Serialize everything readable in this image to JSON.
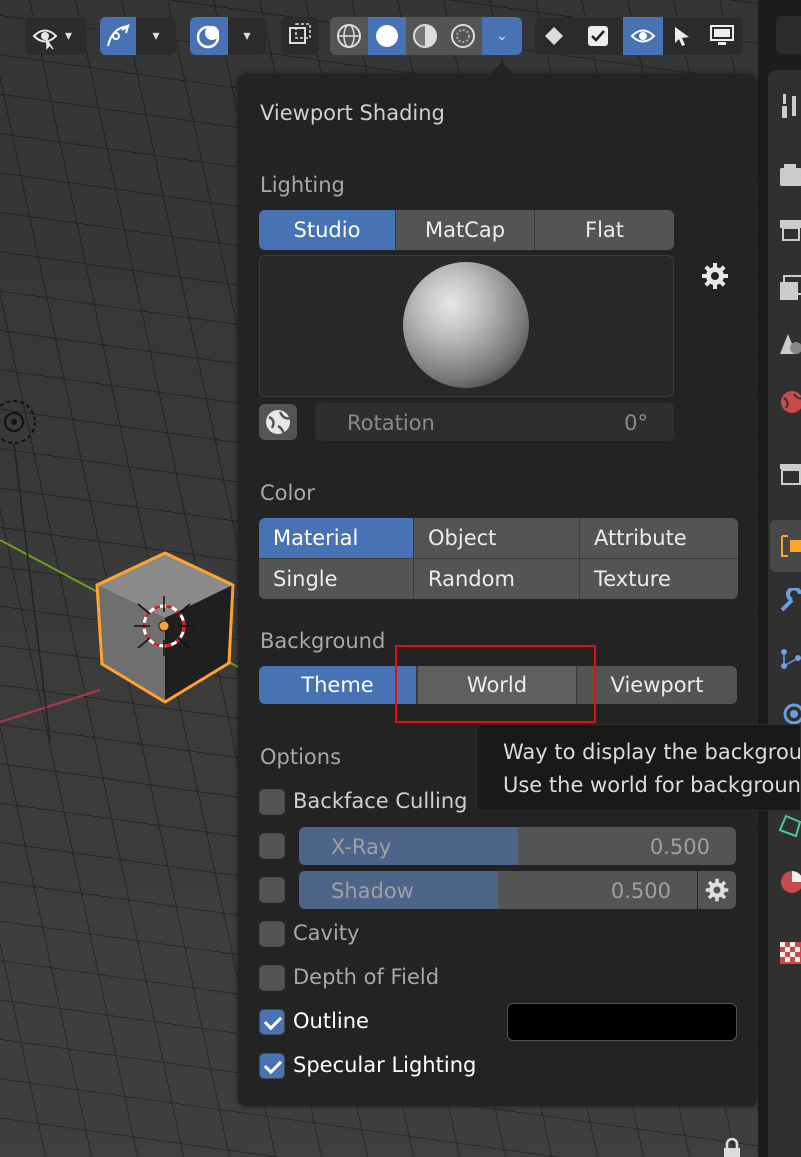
{
  "popover": {
    "title": "Viewport Shading",
    "lighting": {
      "label": "Lighting",
      "options": [
        "Studio",
        "MatCap",
        "Flat"
      ],
      "selected": "Studio",
      "rotation_label": "Rotation",
      "rotation_value": "0°"
    },
    "color": {
      "label": "Color",
      "options": [
        "Material",
        "Object",
        "Attribute",
        "Single",
        "Random",
        "Texture"
      ],
      "selected": "Material"
    },
    "background": {
      "label": "Background",
      "options": [
        "Theme",
        "World",
        "Viewport"
      ],
      "selected": "Theme",
      "highlighted": "World"
    },
    "options": {
      "label": "Options",
      "backface_culling": {
        "label": "Backface Culling",
        "checked": false
      },
      "xray": {
        "label": "X-Ray",
        "value": "0.500",
        "checked": false,
        "fill": 0.5
      },
      "shadow": {
        "label": "Shadow",
        "value": "0.500",
        "checked": false,
        "fill": 0.5
      },
      "cavity": {
        "label": "Cavity",
        "checked": false
      },
      "depth_of_field": {
        "label": "Depth of Field",
        "checked": false
      },
      "outline": {
        "label": "Outline",
        "checked": true,
        "color": "#000000"
      },
      "specular": {
        "label": "Specular Lighting",
        "checked": true
      }
    }
  },
  "tooltip": {
    "line1": "Way to display the backgrou",
    "line2": "Use the world for backgroun"
  },
  "colors": {
    "accent": "#4772b3",
    "button": "#545454",
    "panel": "#232323",
    "selection_outline": "#ffa32e",
    "highlight_box": "#e01010"
  },
  "icons": {
    "header": [
      "eye-icon",
      "curve-icon",
      "overlay-icon",
      "xray-toggle-icon",
      "wireframe-icon",
      "solid-icon",
      "material-preview-icon",
      "rendered-icon",
      "chevron-down-icon",
      "diamond-icon",
      "checkbox-icon",
      "eye-icon",
      "cursor-icon",
      "monitor-icon"
    ],
    "properties_tabs": [
      "tool-icon",
      "render-icon",
      "output-icon",
      "view-layer-icon",
      "scene-icon",
      "world-icon",
      "collection-icon",
      "object-icon",
      "modifier-icon",
      "particles-icon",
      "physics-icon",
      "constraints-icon",
      "data-icon",
      "material-icon",
      "texture-icon"
    ]
  }
}
